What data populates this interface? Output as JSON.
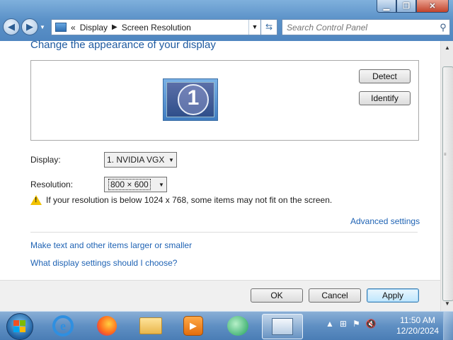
{
  "window": {
    "minimize_icon": "minimize-icon",
    "maximize_icon": "maximize-icon",
    "close_icon": "close-icon"
  },
  "address_bar": {
    "overflow": "«",
    "crumbs": [
      "Display",
      "Screen Resolution"
    ]
  },
  "search": {
    "placeholder": "Search Control Panel"
  },
  "main": {
    "heading": "Change the appearance of your display",
    "detect_label": "Detect",
    "identify_label": "Identify",
    "monitor_number": "1",
    "display_label": "Display:",
    "display_value": "1. NVIDIA VGX",
    "resolution_label": "Resolution:",
    "resolution_value": "800 × 600",
    "warning_text": "If your resolution is below 1024 x 768, some items may not fit on the screen.",
    "advanced_link": "Advanced settings",
    "link_text_size": "Make text and other items larger or smaller",
    "link_choose": "What display settings should I choose?",
    "ok_label": "OK",
    "cancel_label": "Cancel",
    "apply_label": "Apply"
  },
  "taskbar": {
    "apps": [
      "internet-explorer-icon",
      "firefox-icon",
      "file-explorer-icon",
      "media-player-icon",
      "chat-icon",
      "display-settings-icon"
    ],
    "active_app": "display-settings-icon",
    "time": "11:50 AM",
    "date": "12/20/2024"
  },
  "colors": {
    "link": "#1f63b4",
    "heading": "#1e5aa0",
    "taskbar": "#5f8fc3"
  }
}
